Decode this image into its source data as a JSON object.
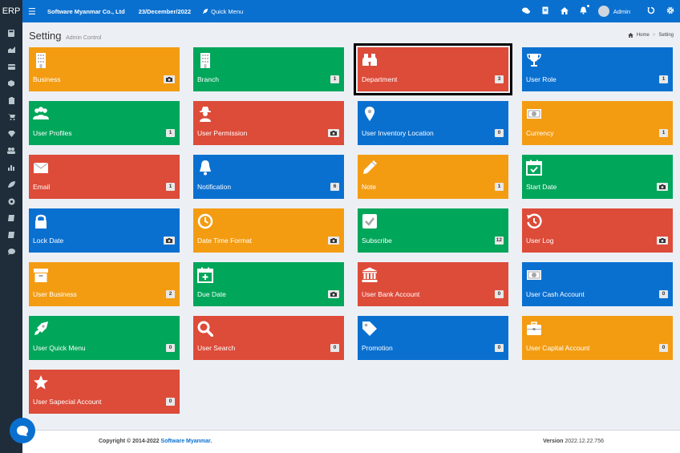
{
  "header": {
    "logo": "ERP",
    "company": "Software Myanmar Co., Ltd",
    "date": "23/December/2022",
    "quick_menu": "Quick Menu",
    "user": "Admin",
    "color": "#0a70d0"
  },
  "sidebar": {
    "icons": [
      "calculator-icon",
      "chart-area-icon",
      "card-icon",
      "box-icon",
      "clipboard-icon",
      "cart-icon",
      "diamond-icon",
      "users-icon",
      "bar-chart-icon",
      "leaf-icon",
      "gear-circle-icon",
      "book-icon",
      "book-icon",
      "chat-icon"
    ]
  },
  "page": {
    "title": "Setting",
    "subtitle": "Admin Control"
  },
  "breadcrumb": {
    "home": "Home",
    "current": "Setting"
  },
  "tiles": [
    {
      "label": "Business",
      "badge": "cam",
      "color": "#f39c12",
      "icon": "building-icon"
    },
    {
      "label": "Branch",
      "badge": "1",
      "color": "#00a65a",
      "icon": "building-icon"
    },
    {
      "label": "Department",
      "badge": "3",
      "color": "#dd4b39",
      "icon": "binoculars-icon",
      "selected": true
    },
    {
      "label": "User Role",
      "badge": "1",
      "color": "#0a70d0",
      "icon": "trophy-icon"
    },
    {
      "label": "User Profiles",
      "badge": "1",
      "color": "#00a65a",
      "icon": "users-icon"
    },
    {
      "label": "User Permission",
      "badge": "cam",
      "color": "#dd4b39",
      "icon": "user-secret-icon"
    },
    {
      "label": "User Inventory Location",
      "badge": "0",
      "color": "#0a70d0",
      "icon": "map-marker-icon"
    },
    {
      "label": "Currency",
      "badge": "1",
      "color": "#f39c12",
      "icon": "money-icon"
    },
    {
      "label": "Email",
      "badge": "1",
      "color": "#dd4b39",
      "icon": "envelope-icon"
    },
    {
      "label": "Notification",
      "badge": "6",
      "color": "#0a70d0",
      "icon": "bell-icon"
    },
    {
      "label": "Note",
      "badge": "1",
      "color": "#f39c12",
      "icon": "pencil-icon"
    },
    {
      "label": "Start Date",
      "badge": "cam",
      "color": "#00a65a",
      "icon": "calendar-check-icon"
    },
    {
      "label": "Lock Date",
      "badge": "cam",
      "color": "#0a70d0",
      "icon": "lock-icon"
    },
    {
      "label": "Date Time Format",
      "badge": "cam",
      "color": "#f39c12",
      "icon": "clock-icon"
    },
    {
      "label": "Subscribe",
      "badge": "12",
      "color": "#00a65a",
      "icon": "check-square-icon"
    },
    {
      "label": "User Log",
      "badge": "cam",
      "color": "#dd4b39",
      "icon": "history-icon"
    },
    {
      "label": "User Business",
      "badge": "2",
      "color": "#f39c12",
      "icon": "archive-icon"
    },
    {
      "label": "Due Date",
      "badge": "cam",
      "color": "#00a65a",
      "icon": "calendar-plus-icon"
    },
    {
      "label": "User Bank Account",
      "badge": "0",
      "color": "#dd4b39",
      "icon": "bank-icon"
    },
    {
      "label": "User Cash Account",
      "badge": "0",
      "color": "#0a70d0",
      "icon": "money-icon"
    },
    {
      "label": "User Quick Menu",
      "badge": "0",
      "color": "#00a65a",
      "icon": "rocket-icon"
    },
    {
      "label": "User Search",
      "badge": "0",
      "color": "#dd4b39",
      "icon": "search-icon"
    },
    {
      "label": "Promotion",
      "badge": "0",
      "color": "#0a70d0",
      "icon": "tag-icon"
    },
    {
      "label": "User Capital Account",
      "badge": "0",
      "color": "#f39c12",
      "icon": "briefcase-icon"
    },
    {
      "label": "User Sapecial Account",
      "badge": "0",
      "color": "#dd4b39",
      "icon": "star-icon"
    }
  ],
  "footer": {
    "copyright": "Copyright © 2014-2022",
    "brand": "Software Myanmar.",
    "version_label": "Version",
    "version": "2022.12.22.756"
  }
}
